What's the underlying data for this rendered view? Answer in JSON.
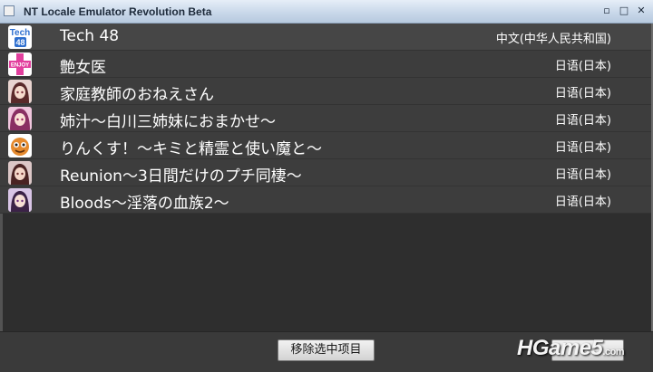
{
  "window": {
    "title": "NT Locale Emulator Revolution Beta",
    "controls": {
      "minimize": "▫",
      "maximize": "□",
      "close": "✕"
    }
  },
  "list": {
    "items": [
      {
        "name": "Tech 48",
        "locale": "中文(中华人民共和国)",
        "icon": "tech48-logo-icon",
        "icon_text": "Tech 48",
        "icon_color": "#3c7fd6"
      },
      {
        "name": "艶女医",
        "locale": "日语(日本)",
        "icon": "enjoy-logo-icon",
        "icon_text": "ENJOY",
        "icon_color": "#e23f9d"
      },
      {
        "name": "家庭教師のおねえさん",
        "locale": "日语(日本)",
        "icon": "anime-portrait-icon",
        "icon_color": "#b76f7d"
      },
      {
        "name": "姉汁～白川三姉妹におまかせ～",
        "locale": "日语(日本)",
        "icon": "anime-portrait-icon",
        "icon_color": "#cf6ea3"
      },
      {
        "name": "りんくす！～キミと精霊と使い魔と～",
        "locale": "日语(日本)",
        "icon": "mascot-face-icon",
        "icon_color": "#e58a2e"
      },
      {
        "name": "Reunion～3日間だけのプチ同棲～",
        "locale": "日语(日本)",
        "icon": "anime-portrait-icon",
        "icon_color": "#9c6b6b"
      },
      {
        "name": "Bloods～淫落の血族2～",
        "locale": "日语(日本)",
        "icon": "anime-portrait-icon",
        "icon_color": "#8d5aa8"
      }
    ]
  },
  "footer": {
    "remove_button": "移除选中项目",
    "watermark_main": "HGame5",
    "watermark_suffix": ".com"
  }
}
